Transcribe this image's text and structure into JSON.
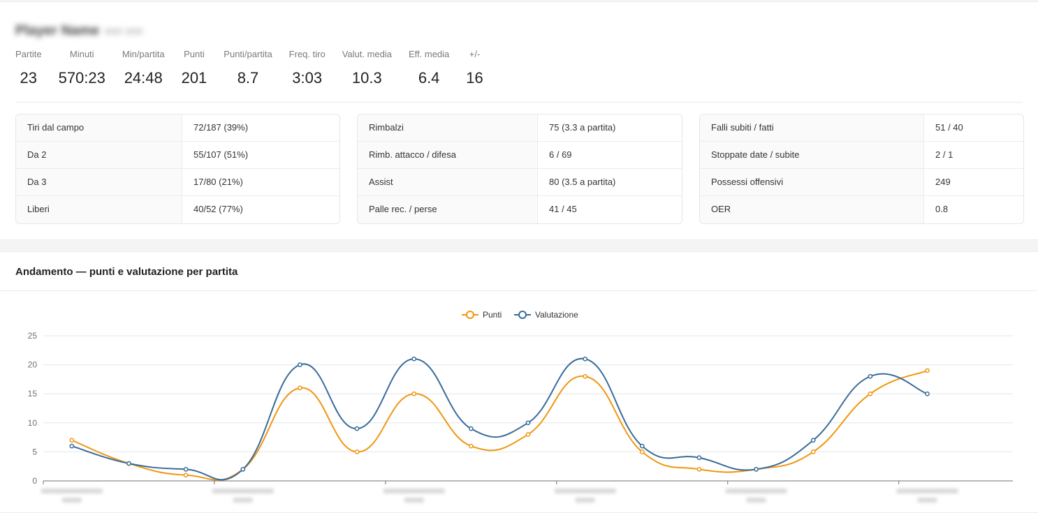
{
  "player": {
    "name": "Player Name",
    "subtitle": "### ###"
  },
  "kpis": [
    {
      "label": "Partite",
      "value": "23"
    },
    {
      "label": "Minuti",
      "value": "570:23"
    },
    {
      "label": "Min/partita",
      "value": "24:48"
    },
    {
      "label": "Punti",
      "value": "201"
    },
    {
      "label": "Punti/partita",
      "value": "8.7"
    },
    {
      "label": "Freq. tiro",
      "value": "3:03"
    },
    {
      "label": "Valut. media",
      "value": "10.3"
    },
    {
      "label": "Eff. media",
      "value": "6.4"
    },
    {
      "label": "+/-",
      "value": "16"
    }
  ],
  "tables": [
    {
      "rows": [
        {
          "key": "Tiri dal campo",
          "value": "72/187 (39%)"
        },
        {
          "key": "Da 2",
          "value": "55/107 (51%)"
        },
        {
          "key": "Da 3",
          "value": "17/80 (21%)"
        },
        {
          "key": "Liberi",
          "value": "40/52 (77%)"
        }
      ]
    },
    {
      "rows": [
        {
          "key": "Rimbalzi",
          "value": "75 (3.3 a partita)"
        },
        {
          "key": "Rimb. attacco / difesa",
          "value": "6 / 69"
        },
        {
          "key": "Assist",
          "value": "80 (3.5 a partita)"
        },
        {
          "key": "Palle rec. / perse",
          "value": "41 / 45"
        }
      ]
    },
    {
      "rows": [
        {
          "key": "Falli subiti / fatti",
          "value": "51 / 40"
        },
        {
          "key": "Stoppate date / subite",
          "value": "2 / 1"
        },
        {
          "key": "Possessi offensivi",
          "value": "249"
        },
        {
          "key": "OER",
          "value": "0.8"
        }
      ]
    }
  ],
  "chart_section": {
    "title": "Andamento — punti e valutazione per partita"
  },
  "chart_data": {
    "type": "line",
    "title": "",
    "xlabel": "",
    "ylabel": "",
    "ylim": [
      0,
      25
    ],
    "yticks": [
      0,
      5,
      10,
      15,
      20,
      25
    ],
    "grid": true,
    "legend_position": "top-center",
    "categories": [
      "",
      "",
      "",
      "",
      "",
      "",
      "",
      "",
      "",
      "",
      "",
      "",
      "",
      "",
      "",
      "",
      ""
    ],
    "series": [
      {
        "name": "Punti",
        "color": "#f0960f",
        "values": [
          7,
          3,
          1,
          2,
          16,
          5,
          15,
          6,
          8,
          18,
          5,
          2,
          2,
          5,
          15,
          19
        ]
      },
      {
        "name": "Valutazione",
        "color": "#3a6b9a",
        "values": [
          6,
          3,
          2,
          2,
          20,
          9,
          21,
          9,
          10,
          21,
          6,
          4,
          2,
          7,
          18,
          15
        ]
      }
    ]
  }
}
